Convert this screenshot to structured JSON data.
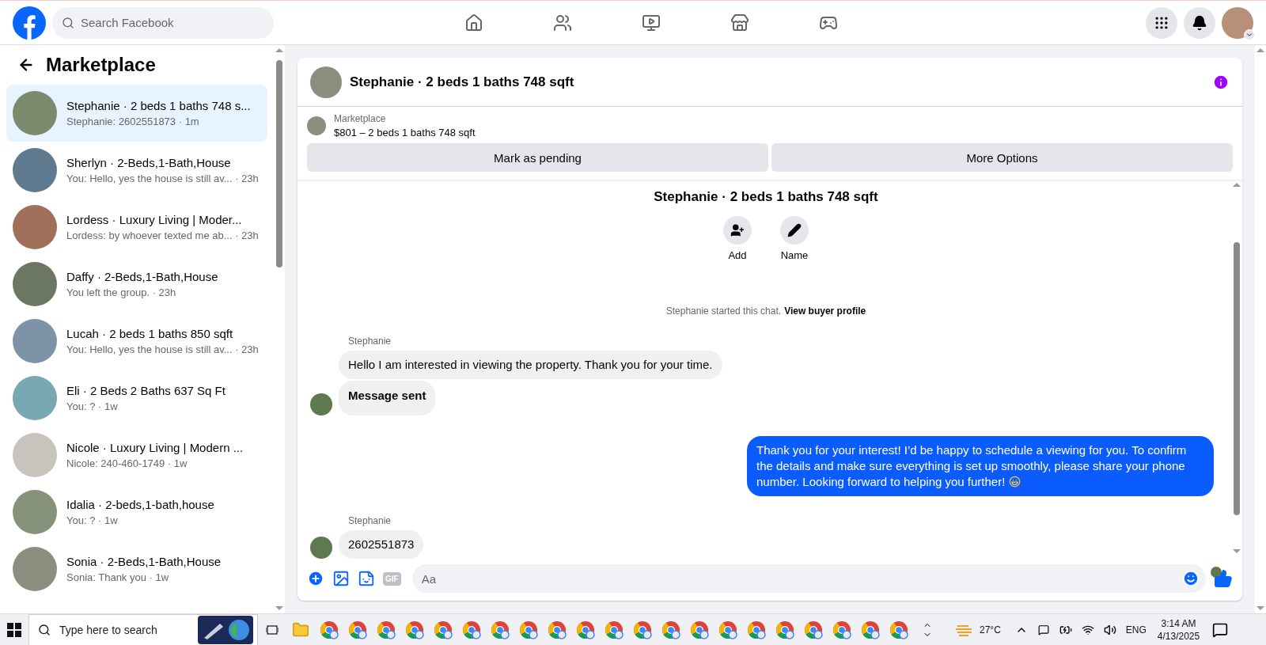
{
  "topbar": {
    "search": {
      "placeholder": "Search Facebook"
    }
  },
  "sidebar": {
    "title": "Marketplace",
    "conversations": [
      {
        "name": "Stephanie · 2 beds 1 baths 748 s...",
        "preview": "Stephanie: 2602551873 · 1m",
        "selected": true
      },
      {
        "name": "Sherlyn · 2-Beds,1-Bath,House",
        "preview": "You: Hello, yes the house is still av... · 23h",
        "selected": false
      },
      {
        "name": "Lordess · Luxury Living | Moder...",
        "preview": "Lordess: by whoever texted me ab... · 23h",
        "selected": false
      },
      {
        "name": "Daffy · 2-Beds,1-Bath,House",
        "preview": "You left the group. · 23h",
        "selected": false
      },
      {
        "name": "Lucah · 2 beds 1 baths 850 sqft",
        "preview": "You: Hello, yes the house is still av... · 23h",
        "selected": false
      },
      {
        "name": "Eli · 2 Beds 2 Baths 637 Sq Ft",
        "preview": "You: ? · 1w",
        "selected": false
      },
      {
        "name": "Nicole · Luxury Living | Modern ...",
        "preview": "Nicole: 240-460-1749 · 1w",
        "selected": false
      },
      {
        "name": "Idalia · 2-beds,1-bath,house",
        "preview": "You: ? · 1w",
        "selected": false
      },
      {
        "name": "Sonia · 2-Beds,1-Bath,House",
        "preview": "Sonia: Thank you · 1w",
        "selected": false
      }
    ]
  },
  "chat": {
    "title": "Stephanie · 2 beds 1 baths 748 sqft",
    "listing": {
      "label": "Marketplace",
      "summary": "$801 – 2 beds 1 baths 748 sqft",
      "buttons": [
        "Mark as pending",
        "More Options"
      ]
    },
    "profile": {
      "title": "Stephanie · 2 beds 1 baths 748 sqft",
      "actions": [
        {
          "kind": "add",
          "label": "Add"
        },
        {
          "kind": "name",
          "label": "Name"
        }
      ]
    },
    "notice": {
      "text": "Stephanie started this chat.",
      "link": "View buyer profile"
    },
    "groups": [
      {
        "kind": "incoming",
        "sender": "Stephanie",
        "messages": [
          {
            "text": "Hello I am interested in viewing the property. Thank you for your time.",
            "bold": false
          },
          {
            "text": "Message sent",
            "bold": true
          }
        ]
      },
      {
        "kind": "outgoing",
        "messages": [
          {
            "text": "Thank you for your interest! I’d be happy to schedule a viewing for you. To confirm the details and make sure everything is set up smoothly, please share your phone number. Looking forward to helping you further!",
            "bold": false
          }
        ]
      },
      {
        "kind": "incoming",
        "sender": "Stephanie",
        "messages": [
          {
            "text": "2602551873",
            "bold": false
          }
        ]
      }
    ],
    "composer": {
      "placeholder": "Aa",
      "gif_label": "GIF"
    }
  },
  "taskbar": {
    "search": {
      "placeholder": "Type here to search"
    },
    "weather": "27°C",
    "language": "ENG",
    "time": "3:14 AM",
    "date": "4/13/2025"
  }
}
